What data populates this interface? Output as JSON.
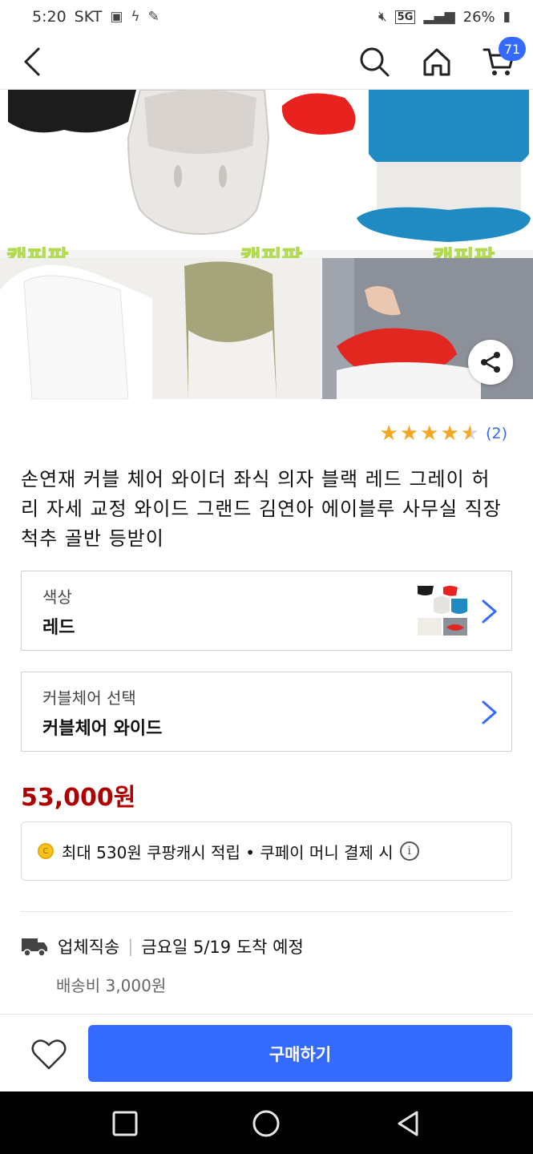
{
  "status_bar": {
    "time": "5:20",
    "carrier": "SKT",
    "network": "5G",
    "battery": "26%"
  },
  "header": {
    "cart_count": "71"
  },
  "product_image": {
    "watermark": "캠핑팜"
  },
  "rating": {
    "stars": 4.5,
    "count": "(2)"
  },
  "title": "손연재 커블 체어 와이더 좌식 의자 블랙 레드 그레이 허리 자세 교정 와이드 그랜드 김연아 에이블루 사무실 직장 척추 골반 등받이",
  "options": [
    {
      "label": "색상",
      "value": "레드"
    },
    {
      "label": "커블체어 선택",
      "value": "커블체어 와이드"
    }
  ],
  "price": "53,000원",
  "cash": {
    "coin_label": "C",
    "text": "최대 530원 쿠팡캐시 적립 • 쿠페이 머니 결제 시",
    "info_label": "i"
  },
  "delivery": {
    "method": "업체직송",
    "arrival": "금요일 5/19 도착 예정",
    "fee": "배송비 3,000원"
  },
  "bottom_bar": {
    "buy_label": "구매하기"
  },
  "colors": {
    "accent": "#346aff",
    "price": "#ae0000",
    "star": "#f5a623"
  }
}
